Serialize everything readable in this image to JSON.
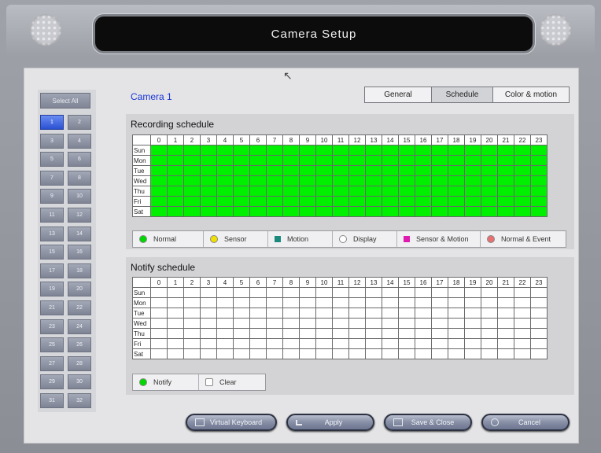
{
  "window": {
    "title": "Camera Setup"
  },
  "sidebar": {
    "select_all": "Select All",
    "cameras": [
      "1",
      "2",
      "3",
      "4",
      "5",
      "6",
      "7",
      "8",
      "9",
      "10",
      "11",
      "12",
      "13",
      "14",
      "15",
      "16",
      "17",
      "18",
      "19",
      "20",
      "21",
      "22",
      "23",
      "24",
      "25",
      "26",
      "27",
      "28",
      "29",
      "30",
      "31",
      "32"
    ],
    "active_camera": "1"
  },
  "main": {
    "camera_title": "Camera 1",
    "tabs": [
      {
        "label": "General",
        "selected": false
      },
      {
        "label": "Schedule",
        "selected": true
      },
      {
        "label": "Color & motion",
        "selected": false
      }
    ]
  },
  "recording": {
    "title": "Recording schedule",
    "hours": [
      "0",
      "1",
      "2",
      "3",
      "4",
      "5",
      "6",
      "7",
      "8",
      "9",
      "10",
      "11",
      "12",
      "13",
      "14",
      "15",
      "16",
      "17",
      "18",
      "19",
      "20",
      "21",
      "22",
      "23"
    ],
    "days": [
      "Sun",
      "Mon",
      "Tue",
      "Wed",
      "Thu",
      "Fri",
      "Sat"
    ],
    "fill_mode": "Normal",
    "legend": [
      {
        "label": "Normal",
        "color": "#00d800",
        "shape": "dot"
      },
      {
        "label": "Sensor",
        "color": "#f0e000",
        "shape": "dot"
      },
      {
        "label": "Motion",
        "color": "#1b8a7c",
        "shape": "square"
      },
      {
        "label": "Display",
        "color": "#ffffff",
        "shape": "dot"
      },
      {
        "label": "Sensor & Motion",
        "color": "#e01ab0",
        "shape": "square"
      },
      {
        "label": "Normal & Event",
        "color": "#e87070",
        "shape": "dot"
      }
    ]
  },
  "notify": {
    "title": "Notify schedule",
    "hours": [
      "0",
      "1",
      "2",
      "3",
      "4",
      "5",
      "6",
      "7",
      "8",
      "9",
      "10",
      "11",
      "12",
      "13",
      "14",
      "15",
      "16",
      "17",
      "18",
      "19",
      "20",
      "21",
      "22",
      "23"
    ],
    "days": [
      "Sun",
      "Mon",
      "Tue",
      "Wed",
      "Thu",
      "Fri",
      "Sat"
    ],
    "legend": [
      {
        "label": "Notify",
        "color": "#00d800"
      },
      {
        "label": "Clear",
        "color": "#ffffff"
      }
    ]
  },
  "buttons": {
    "virtual_keyboard": "Virtual Keyboard",
    "apply": "Apply",
    "save_close": "Save & Close",
    "cancel": "Cancel"
  },
  "colors": {
    "schedule_green": "#00f000",
    "camera_title": "#1a35d8",
    "active_camera": "#2a50d3"
  }
}
